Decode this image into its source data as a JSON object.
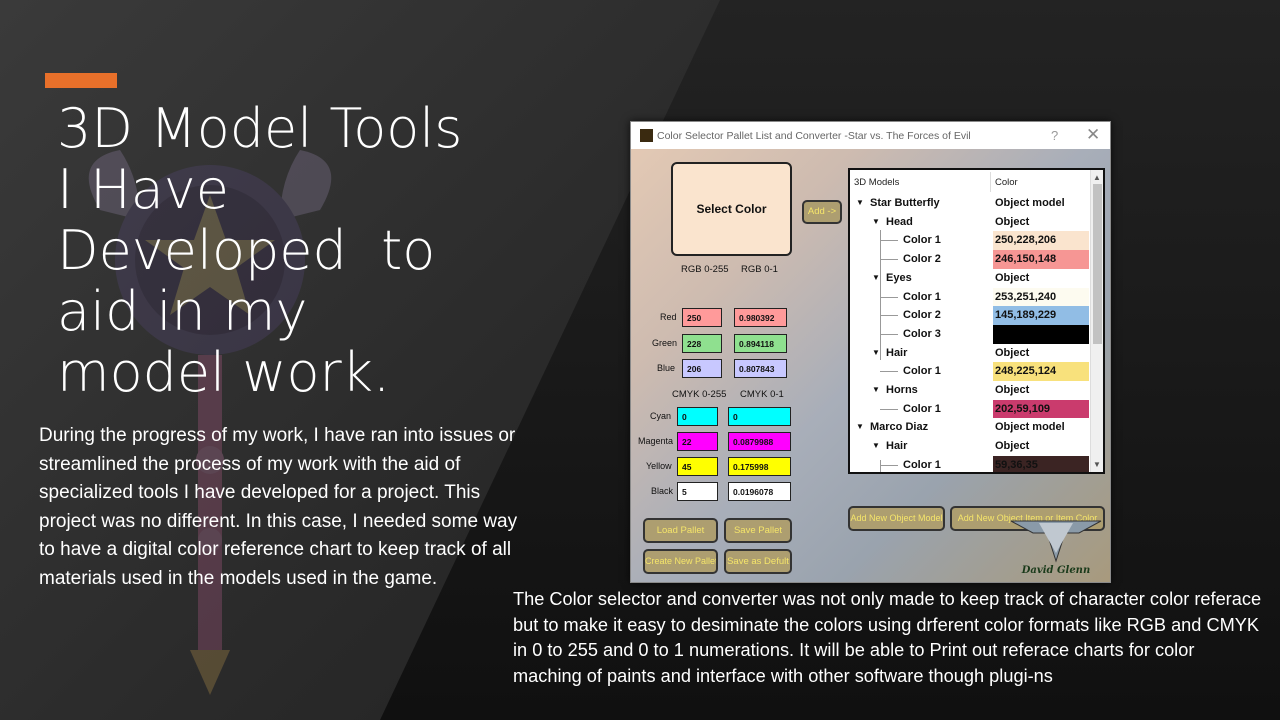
{
  "slide": {
    "title_lines": [
      "3D Model Tools",
      "I Have",
      "Developed  to",
      "aid in my",
      "model work."
    ],
    "body_left": "During the progress of my work, I have ran into issues or streamlined the process of my work with the aid of specialized tools I have developed for a project. This project was no different. In this case, I needed some way to have a digital color reference chart to keep track of all materials used in the models used in the game.",
    "body_right": "The Color selector and converter was not only made to keep track of character color referace but to make it easy to desiminate the colors using drferent color formats like RGB and CMYK in 0 to 255 and 0 to 1 numerations. It will be able to Print out referace charts for color maching of paints and interface with other software though plugi-ns",
    "accent_color": "#e8702a"
  },
  "window": {
    "title": "Color Selector Pallet List and Converter -Star vs. The Forces of Evil",
    "help": "?",
    "close": "✕",
    "select_color_label": "Select Color",
    "selected_color": "#fae4ce",
    "add_label": "Add ->",
    "rgb_header_255": "RGB 0-255",
    "rgb_header_1": "RGB 0-1",
    "cmyk_header_255": "CMYK 0-255",
    "cmyk_header_1": "CMYK 0-1",
    "rgb_rows": [
      {
        "label": "Red",
        "v255": "250",
        "v1": "0.980392",
        "color": "#ff9a9a"
      },
      {
        "label": "Green",
        "v255": "228",
        "v1": "0.894118",
        "color": "#8fe08f"
      },
      {
        "label": "Blue",
        "v255": "206",
        "v1": "0.807843",
        "color": "#c8c8ff"
      }
    ],
    "cmyk_rows": [
      {
        "label": "Cyan",
        "v255": "0",
        "v1": "0",
        "color": "#00ffff"
      },
      {
        "label": "Magenta",
        "v255": "22",
        "v1": "0.0879988",
        "color": "#ff00ff"
      },
      {
        "label": "Yellow",
        "v255": "45",
        "v1": "0.175998",
        "color": "#ffff00"
      },
      {
        "label": "Black",
        "v255": "5",
        "v1": "0.0196078",
        "color": "#ffffff"
      }
    ],
    "buttons": {
      "load": "Load Pallet",
      "save": "Save Pallet",
      "create": "Create New Pallet",
      "save_default": "Save as Defult",
      "add_object": "Add New Object Model",
      "add_item": "Add New Object Item or Item Color"
    },
    "tree": {
      "col1": "3D Models",
      "col2": "Color",
      "rows": [
        {
          "level": 0,
          "expand": true,
          "label": "Star Butterfly",
          "value": "Object model",
          "swatch": ""
        },
        {
          "level": 1,
          "expand": true,
          "label": "Head",
          "value": "Object",
          "swatch": ""
        },
        {
          "level": 2,
          "expand": false,
          "label": "Color 1",
          "value": "250,228,206",
          "swatch": "#fae4ce"
        },
        {
          "level": 2,
          "expand": false,
          "label": "Color 2",
          "value": "246,150,148",
          "swatch": "#f69694"
        },
        {
          "level": 1,
          "expand": true,
          "label": "Eyes",
          "value": "Object",
          "swatch": ""
        },
        {
          "level": 2,
          "expand": false,
          "label": "Color 1",
          "value": "253,251,240",
          "swatch": "#fdfbf0"
        },
        {
          "level": 2,
          "expand": false,
          "label": "Color 2",
          "value": "145,189,229",
          "swatch": "#91bde5"
        },
        {
          "level": 2,
          "expand": false,
          "label": "Color 3",
          "value": "",
          "swatch": "#000000"
        },
        {
          "level": 1,
          "expand": true,
          "label": "Hair",
          "value": "Object",
          "swatch": ""
        },
        {
          "level": 2,
          "expand": false,
          "label": "Color 1",
          "value": "248,225,124",
          "swatch": "#f8e17c"
        },
        {
          "level": 1,
          "expand": true,
          "label": "Horns",
          "value": "Object",
          "swatch": ""
        },
        {
          "level": 2,
          "expand": false,
          "label": "Color 1",
          "value": "202,59,109",
          "swatch": "#ca3b6d"
        },
        {
          "level": 0,
          "expand": true,
          "label": "Marco Diaz",
          "value": "Object model",
          "swatch": ""
        },
        {
          "level": 1,
          "expand": true,
          "label": "Hair",
          "value": "Object",
          "swatch": ""
        },
        {
          "level": 2,
          "expand": false,
          "label": "Color 1",
          "value": "59,36,35",
          "swatch": "#3b2423"
        }
      ]
    },
    "logo_text": "David Glenn"
  }
}
